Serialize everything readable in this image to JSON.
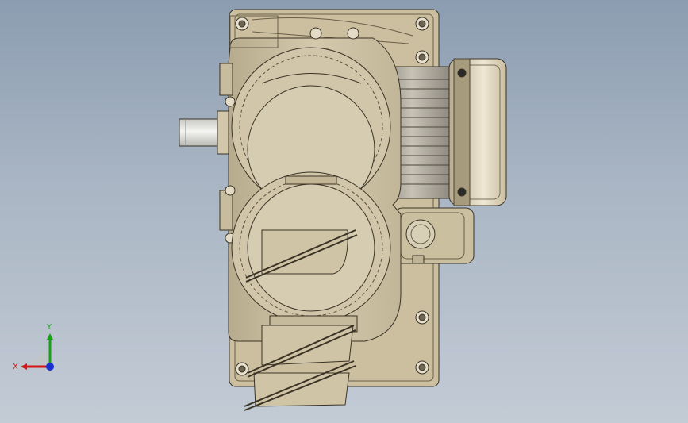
{
  "viewport": {
    "background_top": "#8c9db1",
    "background_bottom": "#c3cbd5"
  },
  "model": {
    "body_color": "#cfc4a8",
    "body_shade": "#b8ac8e",
    "edge_color": "#3a3326",
    "shaft_color": "#e4e4e0",
    "motor_color": "#a9a49a"
  },
  "triad": {
    "x_label": "X",
    "y_label": "Y",
    "x_color": "#d01818",
    "y_color": "#18a018",
    "z_color": "#1a2fd0"
  }
}
